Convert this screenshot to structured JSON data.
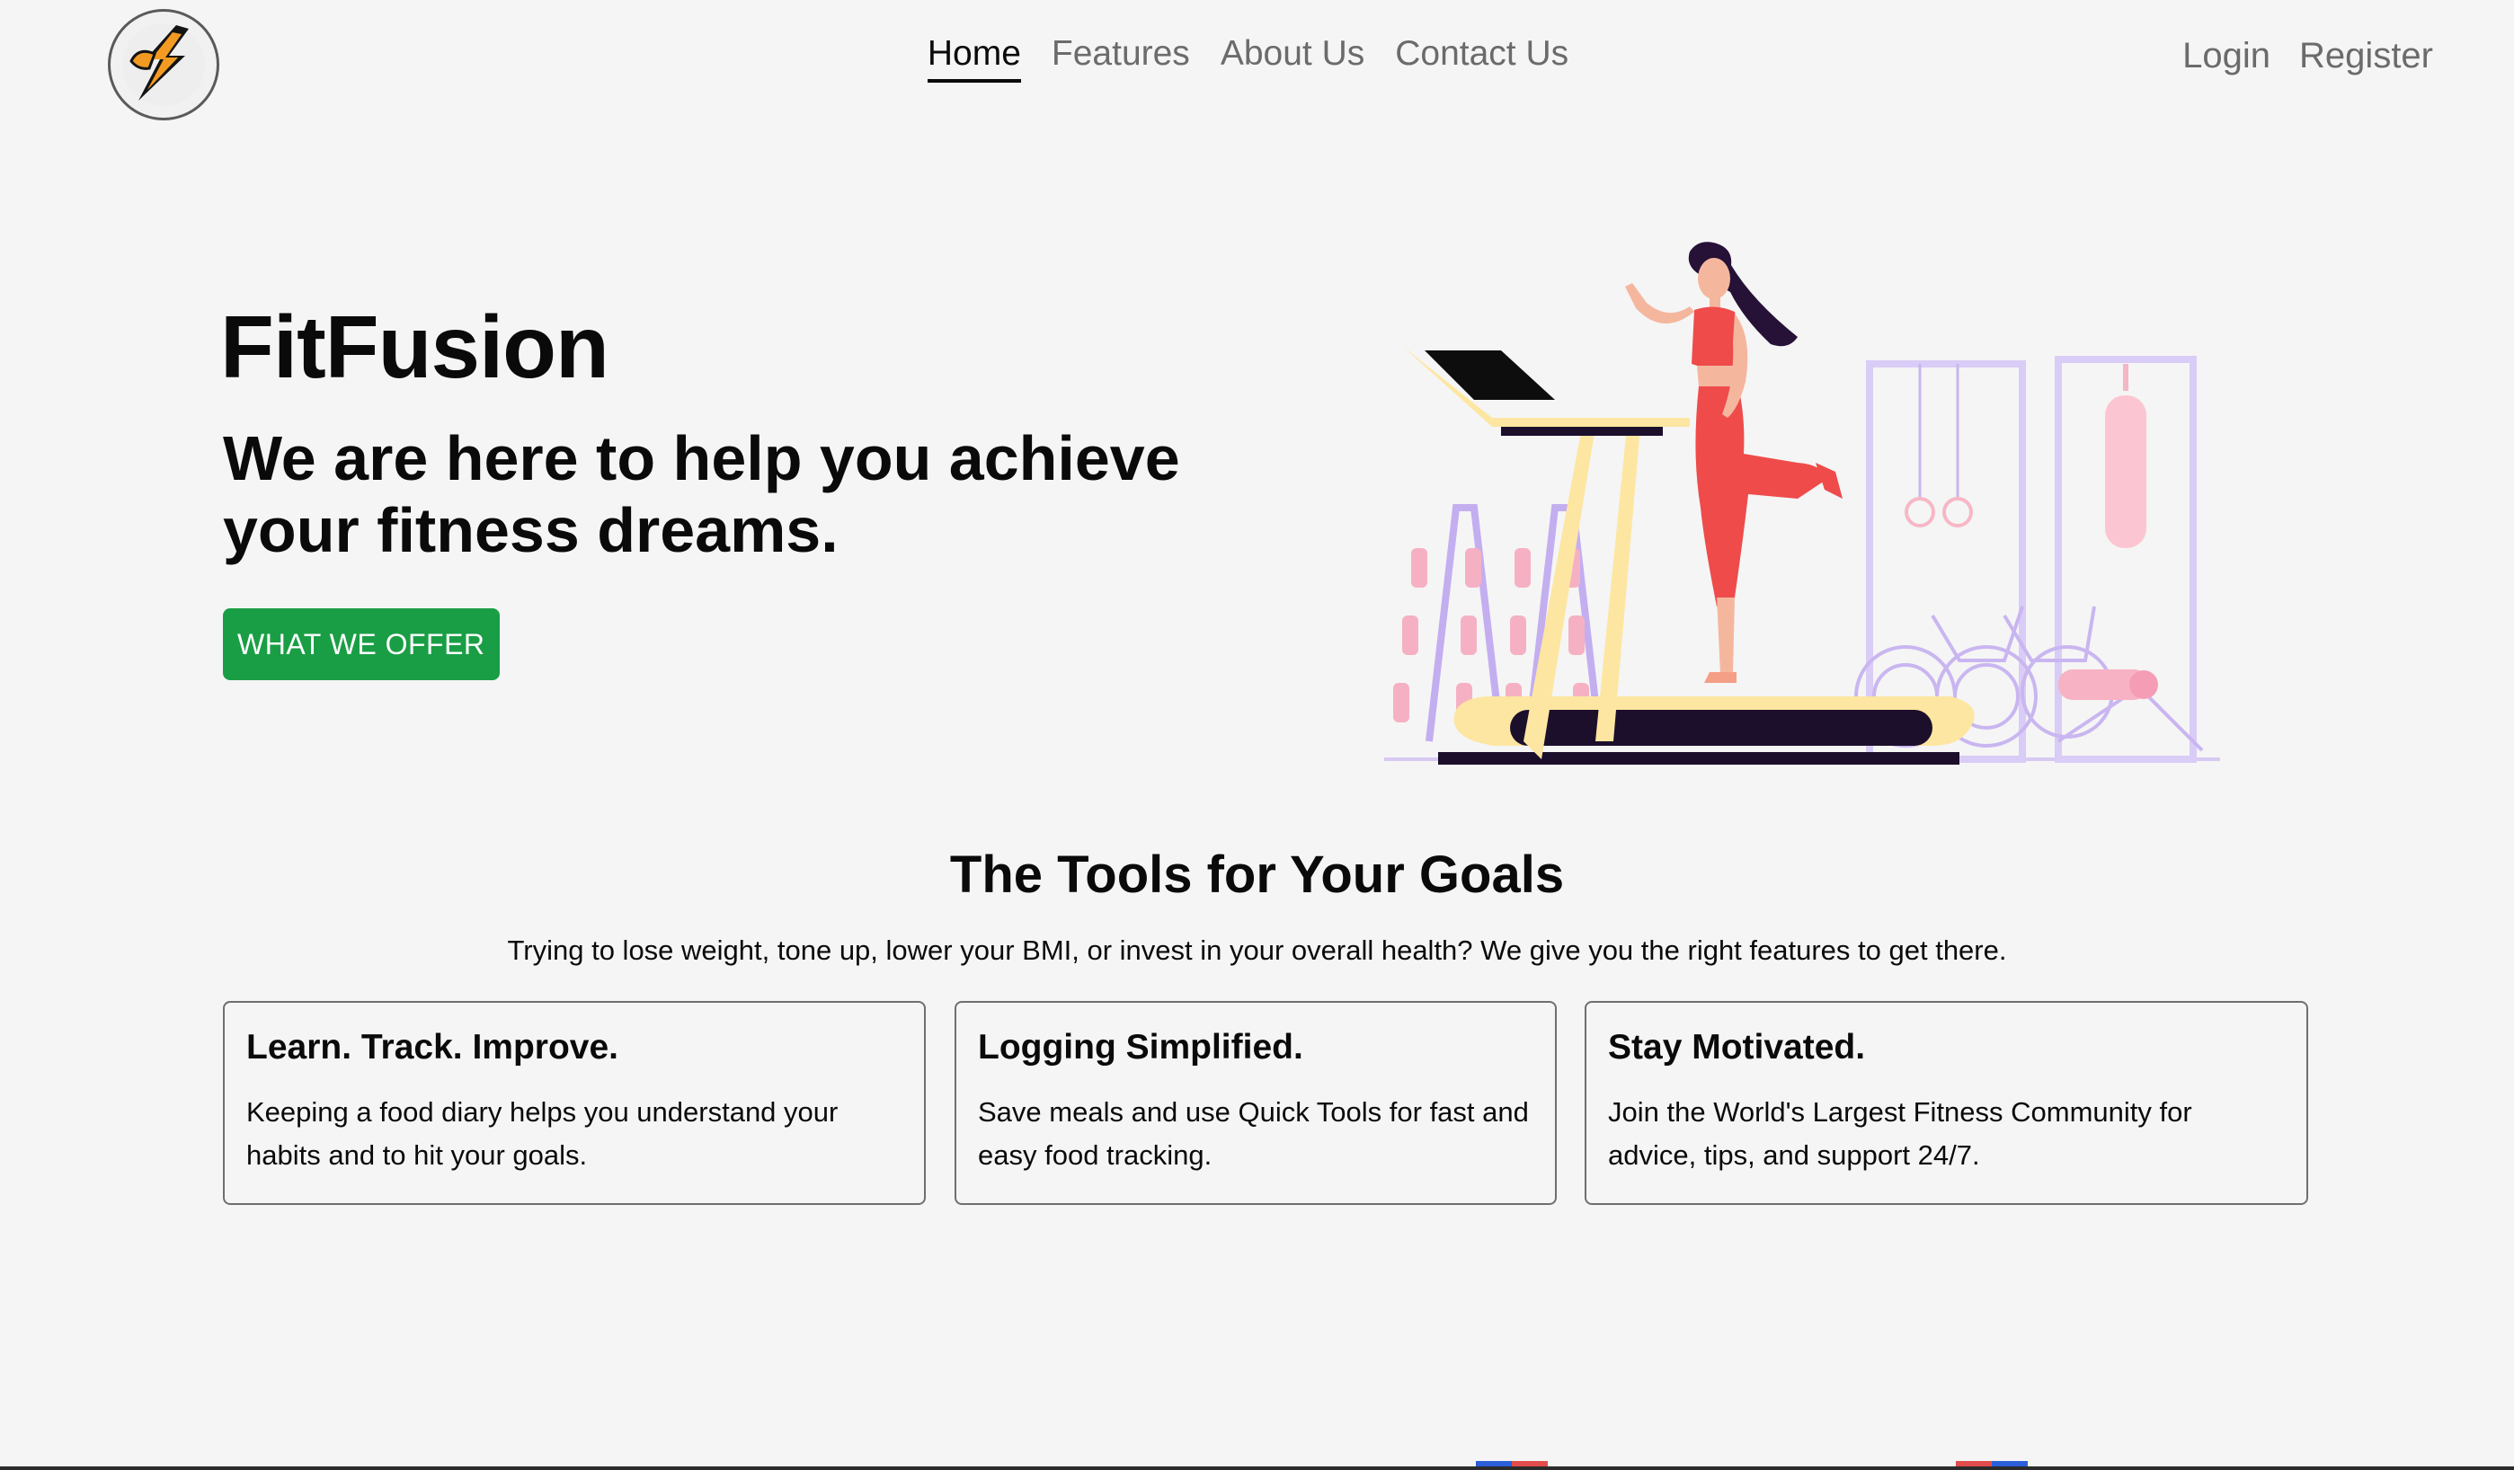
{
  "nav": {
    "logo_icon": "lightning-bolt-icon",
    "links": [
      {
        "label": "Home",
        "active": true
      },
      {
        "label": "Features",
        "active": false
      },
      {
        "label": "About Us",
        "active": false
      },
      {
        "label": "Contact Us",
        "active": false
      }
    ],
    "auth": {
      "login": "Login",
      "register": "Register"
    }
  },
  "hero": {
    "brand": "FitFusion",
    "tagline": "We are here to help you achieve your fitness dreams.",
    "cta_label": "WHAT WE OFFER",
    "illustration": "woman-on-treadmill-illustration"
  },
  "tools": {
    "title": "The Tools for Your Goals",
    "subtitle": "Trying to lose weight, tone up, lower your BMI, or invest in your overall health? We give you the right features to get there.",
    "cards": [
      {
        "title": "Learn. Track. Improve.",
        "body": "Keeping a food diary helps you understand your habits and to hit your goals."
      },
      {
        "title": "Logging Simplified.",
        "body": "Save meals and use Quick Tools for fast and easy food tracking."
      },
      {
        "title": "Stay Motivated.",
        "body": "Join the World's Largest Fitness Community for advice, tips, and support 24/7."
      }
    ]
  },
  "colors": {
    "background": "#f5f5f5",
    "cta": "#1a9e45",
    "nav_inactive": "#6b6b6b",
    "text": "#0a0a0a"
  }
}
